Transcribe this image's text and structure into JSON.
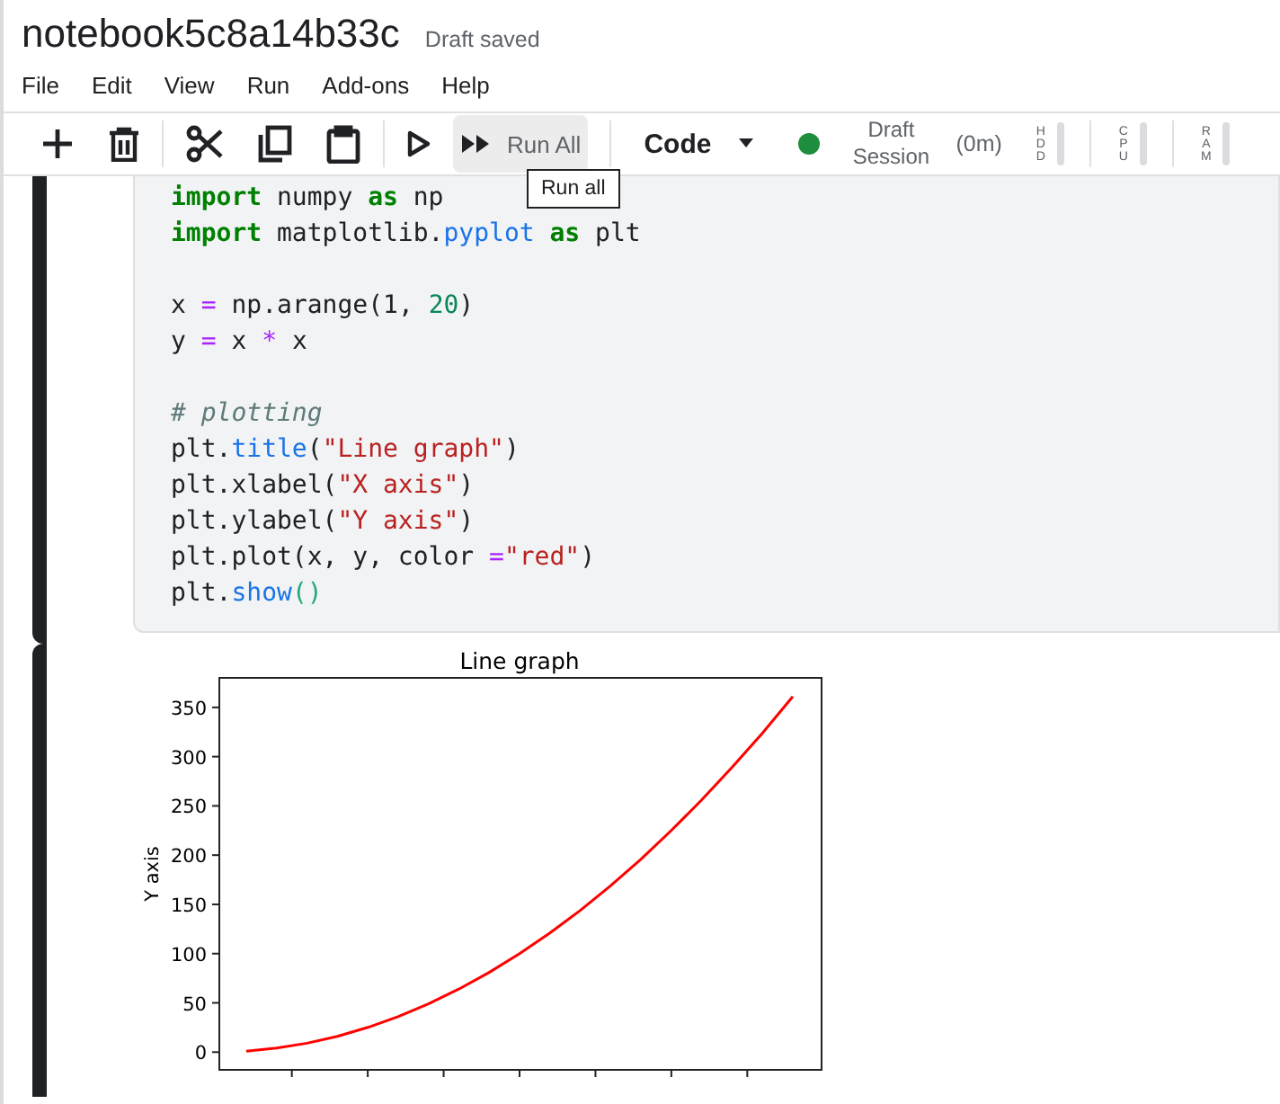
{
  "notebook": {
    "title": "notebook5c8a14b33c",
    "save_status": "Draft saved"
  },
  "menu": [
    "File",
    "Edit",
    "View",
    "Run",
    "Add-ons",
    "Help"
  ],
  "toolbar": {
    "run_all_label": "Run All",
    "cell_type": "Code",
    "session_status": "Draft Session",
    "session_time": "(0m)",
    "meters": [
      {
        "label": "HDD"
      },
      {
        "label": "CPU"
      },
      {
        "label": "RAM"
      }
    ],
    "tooltip": "Run all"
  },
  "code_blocks": [
    [
      [
        {
          "kind": "keyword",
          "text": "import"
        },
        {
          "kind": "plain",
          "text": " numpy "
        },
        {
          "kind": "keyword",
          "text": "as"
        },
        {
          "kind": "plain",
          "text": " np"
        }
      ],
      [
        {
          "kind": "keyword",
          "text": "import"
        },
        {
          "kind": "plain",
          "text": " matplotlib."
        },
        {
          "kind": "attr",
          "text": "pyplot"
        },
        {
          "kind": "keyword",
          "text": " as"
        },
        {
          "kind": "plain",
          "text": " plt"
        }
      ]
    ],
    [
      [
        {
          "kind": "plain",
          "text": "x "
        },
        {
          "kind": "op",
          "text": "="
        },
        {
          "kind": "plain",
          "text": " np.arange(1, "
        },
        {
          "kind": "number",
          "text": "20"
        },
        {
          "kind": "plain",
          "text": ")"
        }
      ],
      [
        {
          "kind": "plain",
          "text": "y "
        },
        {
          "kind": "op",
          "text": "="
        },
        {
          "kind": "plain",
          "text": " x "
        },
        {
          "kind": "op",
          "text": "*"
        },
        {
          "kind": "plain",
          "text": " x"
        }
      ]
    ],
    [
      [
        {
          "kind": "comment",
          "text": "# plotting"
        }
      ],
      [
        {
          "kind": "plain",
          "text": "plt."
        },
        {
          "kind": "attr",
          "text": "title"
        },
        {
          "kind": "plain",
          "text": "("
        },
        {
          "kind": "string",
          "text": "\"Line graph\""
        },
        {
          "kind": "plain",
          "text": ")"
        }
      ],
      [
        {
          "kind": "plain",
          "text": "plt.xlabel("
        },
        {
          "kind": "string",
          "text": "\"X axis\""
        },
        {
          "kind": "plain",
          "text": ")"
        }
      ],
      [
        {
          "kind": "plain",
          "text": "plt.ylabel("
        },
        {
          "kind": "string",
          "text": "\"Y axis\""
        },
        {
          "kind": "plain",
          "text": ")"
        }
      ],
      [
        {
          "kind": "plain",
          "text": "plt.plot(x, y, color "
        },
        {
          "kind": "op",
          "text": "="
        },
        {
          "kind": "string",
          "text": "\"red\""
        },
        {
          "kind": "plain",
          "text": ")"
        }
      ],
      [
        {
          "kind": "plain",
          "text": "plt."
        },
        {
          "kind": "attr",
          "text": "show"
        },
        {
          "kind": "bracket",
          "text": "()"
        }
      ]
    ]
  ],
  "output": {
    "chart_data": {
      "type": "line",
      "title": "Line graph",
      "ylabel": "Y axis",
      "categories": [
        null,
        null,
        null,
        null,
        null,
        null,
        null,
        null,
        null,
        null,
        null,
        null,
        null,
        null,
        null,
        null,
        null,
        null,
        null
      ],
      "ylim": [
        -18,
        380
      ],
      "yticks": [
        0,
        50,
        100,
        150,
        200,
        250,
        300,
        350
      ],
      "series": [
        {
          "color": "#ff0000",
          "values": [
            1,
            4,
            9,
            16,
            25,
            36,
            49,
            64,
            81,
            100,
            121,
            144,
            169,
            196,
            225,
            256,
            289,
            324,
            361
          ]
        }
      ]
    }
  }
}
